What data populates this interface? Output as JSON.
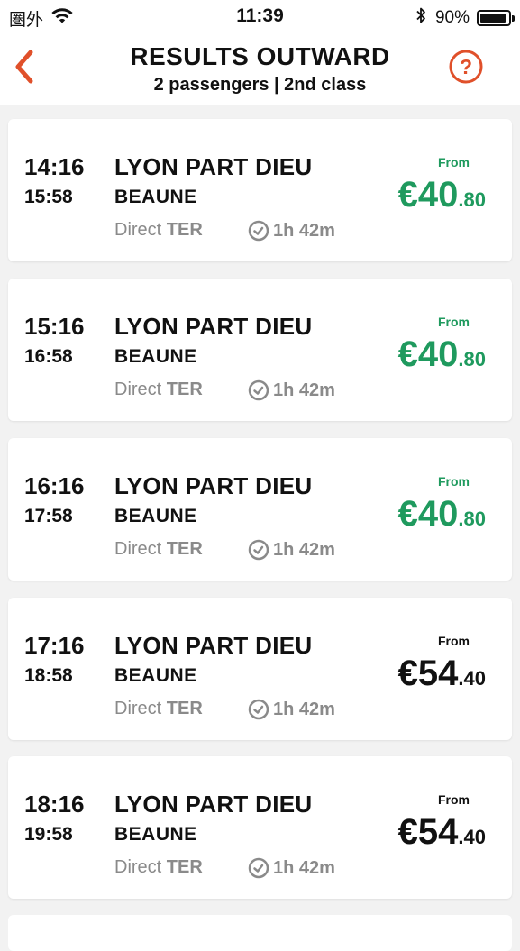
{
  "status_bar": {
    "carrier": "圏外",
    "time": "11:39",
    "battery": "90%",
    "icons": [
      "wifi-icon",
      "bluetooth-icon",
      "battery-icon"
    ]
  },
  "header": {
    "title": "RESULTS OUTWARD",
    "subtitle": "2 passengers | 2nd class",
    "accent_color": "#e0502a"
  },
  "colors": {
    "cheap_price": "#1f9a5e",
    "regular_price": "#111111",
    "muted_text": "#8a8a8a"
  },
  "results": [
    {
      "departure": "14:16",
      "arrival": "15:58",
      "origin": "LYON PART DIEU",
      "destination": "BEAUNE",
      "type_label": "Direct",
      "type_code": "TER",
      "duration": "1h 42m",
      "from_label": "From",
      "price_main": "€40",
      "price_cents": ".80",
      "cheapest": true
    },
    {
      "departure": "15:16",
      "arrival": "16:58",
      "origin": "LYON PART DIEU",
      "destination": "BEAUNE",
      "type_label": "Direct",
      "type_code": "TER",
      "duration": "1h 42m",
      "from_label": "From",
      "price_main": "€40",
      "price_cents": ".80",
      "cheapest": true
    },
    {
      "departure": "16:16",
      "arrival": "17:58",
      "origin": "LYON PART DIEU",
      "destination": "BEAUNE",
      "type_label": "Direct",
      "type_code": "TER",
      "duration": "1h 42m",
      "from_label": "From",
      "price_main": "€40",
      "price_cents": ".80",
      "cheapest": true
    },
    {
      "departure": "17:16",
      "arrival": "18:58",
      "origin": "LYON PART DIEU",
      "destination": "BEAUNE",
      "type_label": "Direct",
      "type_code": "TER",
      "duration": "1h 42m",
      "from_label": "From",
      "price_main": "€54",
      "price_cents": ".40",
      "cheapest": false
    },
    {
      "departure": "18:16",
      "arrival": "19:58",
      "origin": "LYON PART DIEU",
      "destination": "BEAUNE",
      "type_label": "Direct",
      "type_code": "TER",
      "duration": "1h 42m",
      "from_label": "From",
      "price_main": "€54",
      "price_cents": ".40",
      "cheapest": false
    }
  ]
}
